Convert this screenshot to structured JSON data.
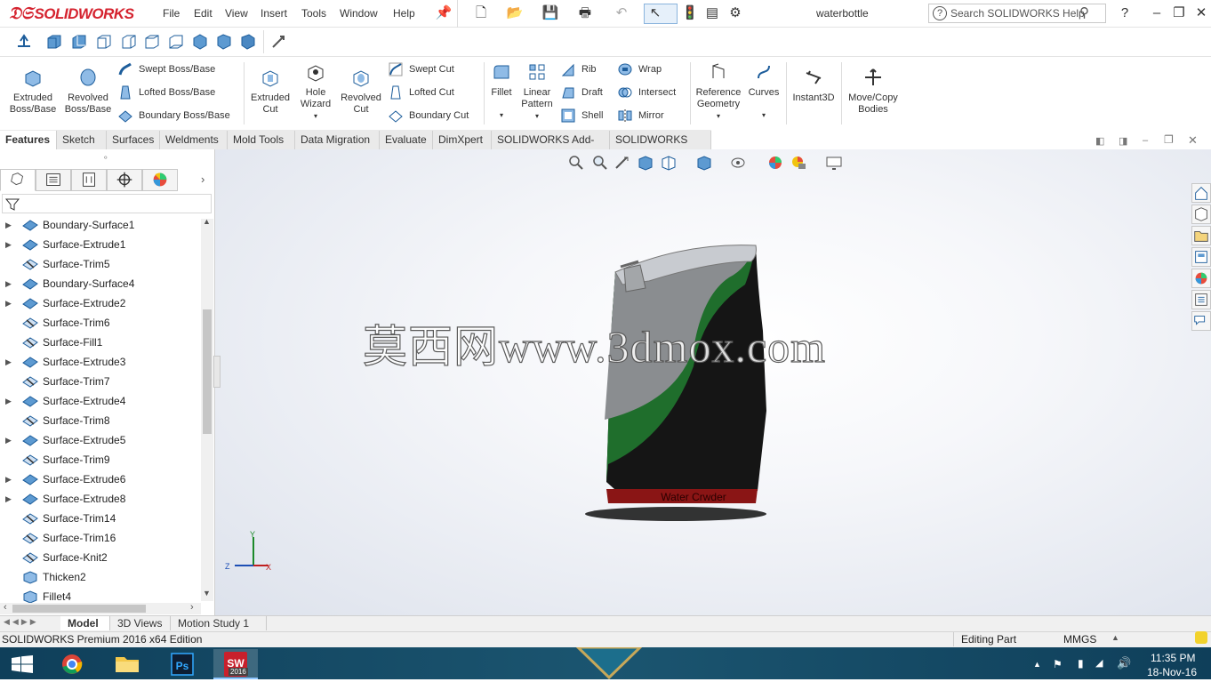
{
  "app": {
    "logo": "SOLIDWORKS",
    "document_title": "waterbottle"
  },
  "menu": [
    "File",
    "Edit",
    "View",
    "Insert",
    "Tools",
    "Window",
    "Help"
  ],
  "help_search": {
    "placeholder": "Search SOLIDWORKS Help",
    "help_mark": "?"
  },
  "ribbon": {
    "extruded_boss": "Extruded Boss/Base",
    "revolved_boss": "Revolved Boss/Base",
    "swept_boss": "Swept Boss/Base",
    "lofted_boss": "Lofted Boss/Base",
    "boundary_boss": "Boundary Boss/Base",
    "extruded_cut": "Extruded Cut",
    "hole_wizard": "Hole Wizard",
    "revolved_cut": "Revolved Cut",
    "swept_cut": "Swept Cut",
    "lofted_cut": "Lofted Cut",
    "boundary_cut": "Boundary Cut",
    "fillet": "Fillet",
    "linear_pattern": "Linear Pattern",
    "rib": "Rib",
    "draft": "Draft",
    "shell": "Shell",
    "wrap": "Wrap",
    "intersect": "Intersect",
    "mirror": "Mirror",
    "reference_geometry": "Reference Geometry",
    "curves": "Curves",
    "instant3d": "Instant3D",
    "move_copy": "Move/Copy Bodies"
  },
  "command_tabs": [
    "Features",
    "Sketch",
    "Surfaces",
    "Weldments",
    "Mold Tools",
    "Data Migration",
    "Evaluate",
    "DimXpert",
    "SOLIDWORKS Add-Ins",
    "SOLIDWORKS MBD"
  ],
  "tree_items": [
    {
      "label": "Boundary-Surface1",
      "expandable": true
    },
    {
      "label": "Surface-Extrude1",
      "expandable": true
    },
    {
      "label": "Surface-Trim5",
      "expandable": false
    },
    {
      "label": "Boundary-Surface4",
      "expandable": true
    },
    {
      "label": "Surface-Extrude2",
      "expandable": true
    },
    {
      "label": "Surface-Trim6",
      "expandable": false
    },
    {
      "label": "Surface-Fill1",
      "expandable": false
    },
    {
      "label": "Surface-Extrude3",
      "expandable": true
    },
    {
      "label": "Surface-Trim7",
      "expandable": false
    },
    {
      "label": "Surface-Extrude4",
      "expandable": true
    },
    {
      "label": "Surface-Trim8",
      "expandable": false
    },
    {
      "label": "Surface-Extrude5",
      "expandable": true
    },
    {
      "label": "Surface-Trim9",
      "expandable": false
    },
    {
      "label": "Surface-Extrude6",
      "expandable": true
    },
    {
      "label": "Surface-Extrude8",
      "expandable": true
    },
    {
      "label": "Surface-Trim14",
      "expandable": false
    },
    {
      "label": "Surface-Trim16",
      "expandable": false
    },
    {
      "label": "Surface-Knit2",
      "expandable": false
    },
    {
      "label": "Thicken2",
      "expandable": false
    },
    {
      "label": "Fillet4",
      "expandable": false
    }
  ],
  "bottom_tabs": [
    "Model",
    "3D Views",
    "Motion Study 1"
  ],
  "status": {
    "edition": "SOLIDWORKS Premium 2016 x64 Edition",
    "mode": "Editing Part",
    "units": "MMGS"
  },
  "watermark": "莫西网www.3dmox.com",
  "model_label": "Water Crwder",
  "triad": {
    "x": "X",
    "y": "Y",
    "z": "Z"
  },
  "taskbar": {
    "time": "11:35 PM",
    "date": "18-Nov-16",
    "sw_badge": "2016"
  },
  "colors": {
    "accent_red": "#d5232f",
    "bottle_green": "#1f6e2c",
    "bottle_grey": "#8a8d90",
    "bottle_black": "#151515",
    "band_red": "#8a1515"
  }
}
